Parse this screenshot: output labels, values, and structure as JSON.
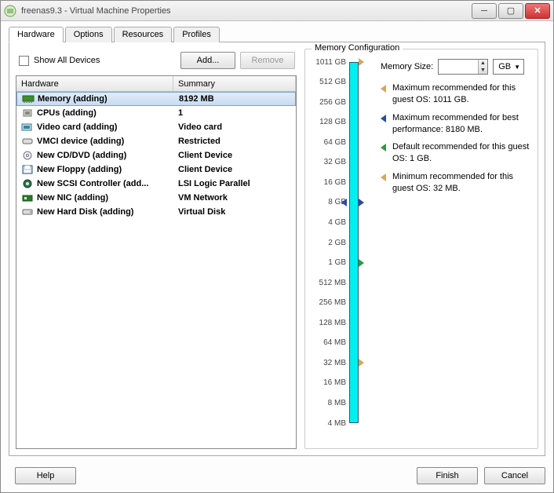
{
  "window": {
    "title": "freenas9.3 - Virtual Machine Properties"
  },
  "tabs": {
    "items": [
      "Hardware",
      "Options",
      "Resources",
      "Profiles"
    ],
    "active": 0
  },
  "toolbar": {
    "show_all_label": "Show All Devices",
    "add_label": "Add...",
    "remove_label": "Remove"
  },
  "hw_table": {
    "headers": {
      "hardware": "Hardware",
      "summary": "Summary"
    },
    "rows": [
      {
        "icon": "memory",
        "name": "Memory (adding)",
        "summary": "8192 MB",
        "selected": true
      },
      {
        "icon": "cpu",
        "name": "CPUs (adding)",
        "summary": "1"
      },
      {
        "icon": "video",
        "name": "Video card  (adding)",
        "summary": "Video card"
      },
      {
        "icon": "vmci",
        "name": "VMCI device (adding)",
        "summary": "Restricted"
      },
      {
        "icon": "cd",
        "name": "New CD/DVD (adding)",
        "summary": "Client Device"
      },
      {
        "icon": "floppy",
        "name": "New Floppy (adding)",
        "summary": "Client Device"
      },
      {
        "icon": "scsi",
        "name": "New SCSI Controller (add...",
        "summary": "LSI Logic Parallel"
      },
      {
        "icon": "nic",
        "name": "New NIC (adding)",
        "summary": "VM Network"
      },
      {
        "icon": "disk",
        "name": "New Hard Disk (adding)",
        "summary": "Virtual Disk"
      }
    ]
  },
  "memory": {
    "group_title": "Memory Configuration",
    "size_label": "Memory Size:",
    "size_value": "",
    "unit": "GB",
    "ruler": [
      "1011 GB",
      "512 GB",
      "256 GB",
      "128 GB",
      "64 GB",
      "32 GB",
      "16 GB",
      "8 GB",
      "4 GB",
      "2 GB",
      "1 GB",
      "512 MB",
      "256 MB",
      "128 MB",
      "64 MB",
      "32 MB",
      "16 MB",
      "8 MB",
      "4 MB"
    ],
    "markers": {
      "max_os_idx": 0,
      "max_perf_idx": 7,
      "default_idx": 10,
      "min_idx": 15,
      "current_idx": 7
    },
    "recs": [
      {
        "color": "#d2a95a",
        "text": "Maximum recommended for this guest OS: 1011 GB."
      },
      {
        "color": "#2b4ba0",
        "text": "Maximum recommended for best performance: 8180 MB."
      },
      {
        "color": "#2f9a3a",
        "text": "Default recommended for this guest OS: 1 GB."
      },
      {
        "color": "#d2a95a",
        "text": "Minimum recommended for this guest OS: 32 MB."
      }
    ]
  },
  "footer": {
    "help": "Help",
    "finish": "Finish",
    "cancel": "Cancel"
  }
}
